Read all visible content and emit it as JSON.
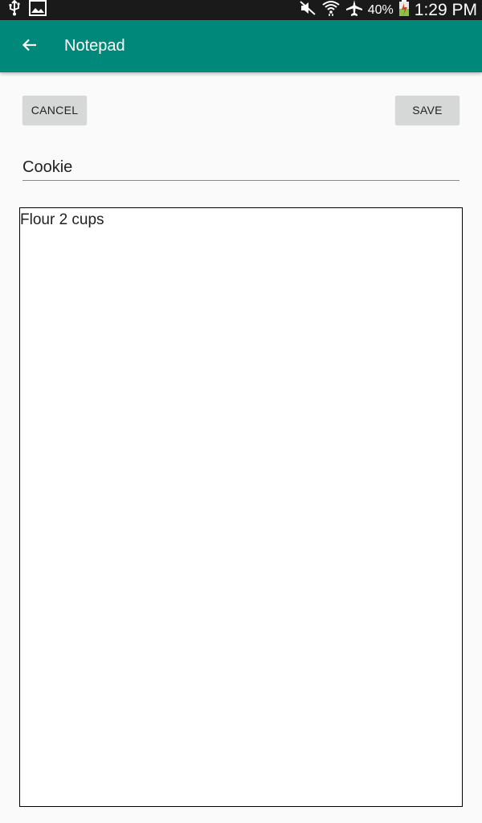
{
  "status_bar": {
    "icons_left": [
      "usb-icon",
      "image-icon"
    ],
    "icons_right": [
      "mute-icon",
      "wifi-icon",
      "airplane-icon",
      "battery-icon"
    ],
    "battery_percent": "40%",
    "time": "1:29 PM"
  },
  "app_bar": {
    "title": "Notepad",
    "back_icon": "arrow-back-icon",
    "color": "#00897b"
  },
  "actions": {
    "cancel_label": "CANCEL",
    "save_label": "SAVE"
  },
  "note": {
    "title_value": "Cookie",
    "body_value": "Flour 2 cups"
  }
}
